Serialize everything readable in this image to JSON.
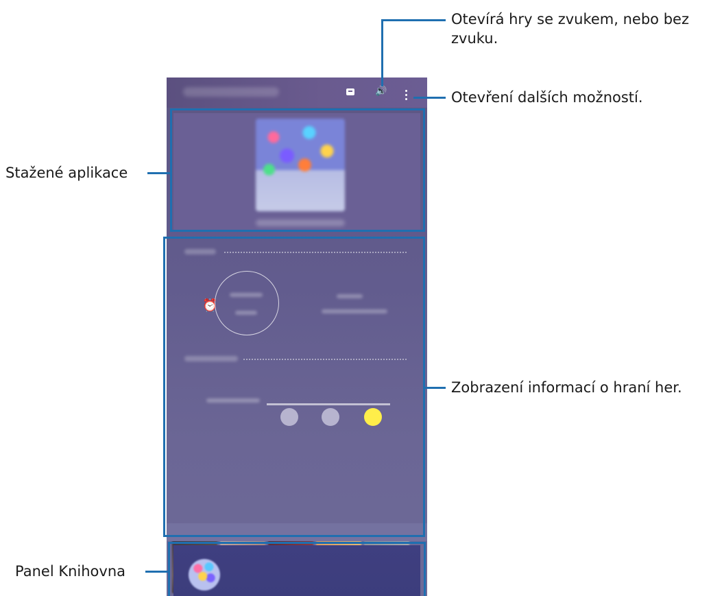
{
  "callouts": {
    "sound_toggle": "Otevírá hry se zvukem, nebo bez zvuku.",
    "more_options": "Otevření dalších možností.",
    "downloaded_apps": "Stažené aplikace",
    "game_info": "Zobrazení informací o hraní her.",
    "library_panel": "Panel Knihovna"
  },
  "icons": {
    "chat": "chat-icon",
    "sound": "volume-icon",
    "more": "more-vertical-icon",
    "alarm": "alarm-clock-icon"
  },
  "colors": {
    "callout_blue": "#1f6fb0",
    "accent_yellow": "#ffee4a"
  }
}
